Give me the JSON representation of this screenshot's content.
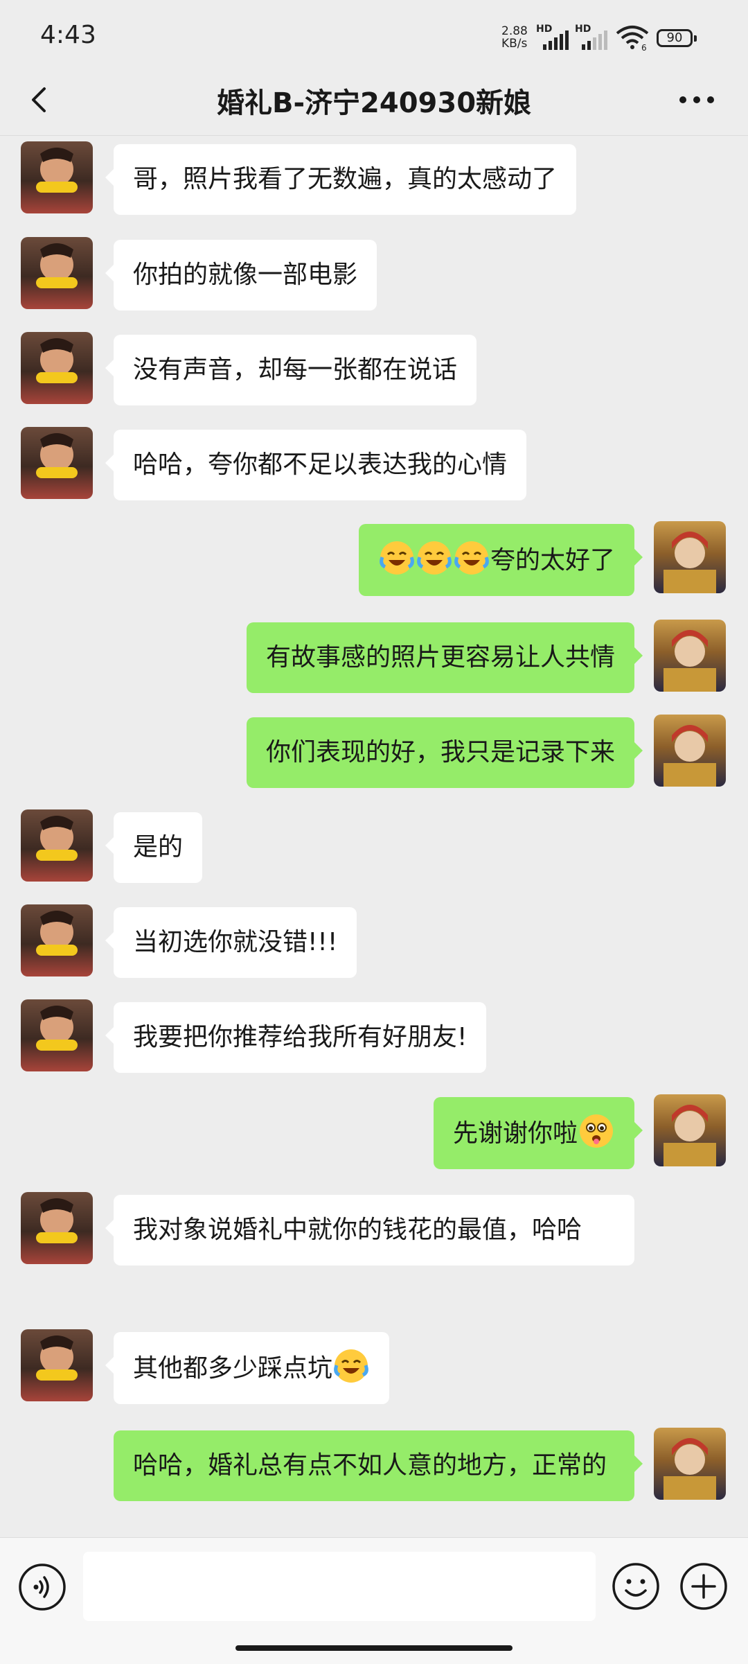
{
  "status_bar": {
    "time": "4:43",
    "net_speed_value": "2.88",
    "net_speed_unit": "KB/s",
    "signal_label_1": "HD",
    "signal_label_2": "HD",
    "wifi_label": "6",
    "battery": "90"
  },
  "header": {
    "title": "婚礼B-济宁240930新娘",
    "back_icon": "chevron-left-icon",
    "more_icon": "more-dots-icon"
  },
  "messages": [
    {
      "side": "in",
      "text": "哥，照片我看了无数遍，真的太感动了"
    },
    {
      "side": "in",
      "text": "你拍的就像一部电影"
    },
    {
      "side": "in",
      "text": "没有声音，却每一张都在说话"
    },
    {
      "side": "in",
      "text": "哈哈，夸你都不足以表达我的心情"
    },
    {
      "side": "out",
      "text": "夸的太好了",
      "emoji_prefix": [
        "laugh-cry-emoji",
        "laugh-cry-emoji",
        "laugh-cry-emoji"
      ]
    },
    {
      "side": "out",
      "text": "有故事感的照片更容易让人共情"
    },
    {
      "side": "out",
      "text": "你们表现的好，我只是记录下来"
    },
    {
      "side": "in",
      "text": "是的"
    },
    {
      "side": "in",
      "text": "当初选你就没错!!!"
    },
    {
      "side": "in",
      "text": "我要把你推荐给我所有好朋友!"
    },
    {
      "side": "out",
      "text": "先谢谢你啦",
      "emoji_suffix": [
        "pleading-tongue-emoji"
      ]
    },
    {
      "side": "in",
      "text": "我对象说婚礼中就你的钱花的最值，哈哈"
    },
    {
      "side": "in",
      "text": "其他都多少踩点坑",
      "emoji_suffix": [
        "laugh-cry-emoji"
      ]
    },
    {
      "side": "out",
      "text": "哈哈，婚礼总有点不如人意的地方，正常的"
    }
  ],
  "input_bar": {
    "voice_icon": "voice-icon",
    "input_value": "",
    "emoji_icon": "smiley-icon",
    "plus_icon": "plus-icon"
  },
  "colors": {
    "chat_background": "#ededed",
    "incoming_bubble": "#ffffff",
    "outgoing_bubble": "#95ec69"
  }
}
